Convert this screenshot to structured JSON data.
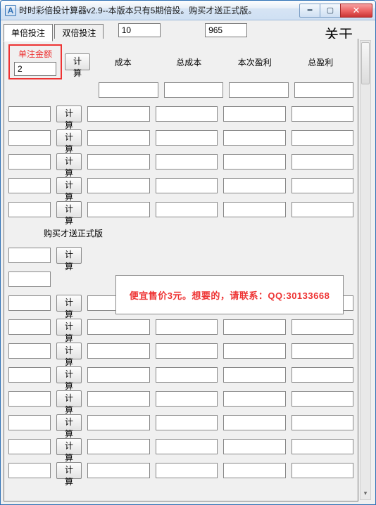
{
  "window": {
    "title": "时时彩倍投计算器v2.9--本版本只有5期倍投。购买才送正式版。"
  },
  "tabs": {
    "tab1": "单倍投注",
    "tab2": "双倍投注",
    "top_input1": "10",
    "top_input2": "965",
    "about": "关于"
  },
  "headers": {
    "amount_label": "单注金额",
    "cost": "成本",
    "total_cost": "总成本",
    "this_profit": "本次盈利",
    "total_profit": "总盈利"
  },
  "amount_value": "2",
  "calc_label": "计算",
  "section2_title": "购买才送正式版",
  "promo": "便宜售价3元。想要的，请联系：QQ:30133668",
  "rows_top_count": 6,
  "rows_bottom_count": 9
}
